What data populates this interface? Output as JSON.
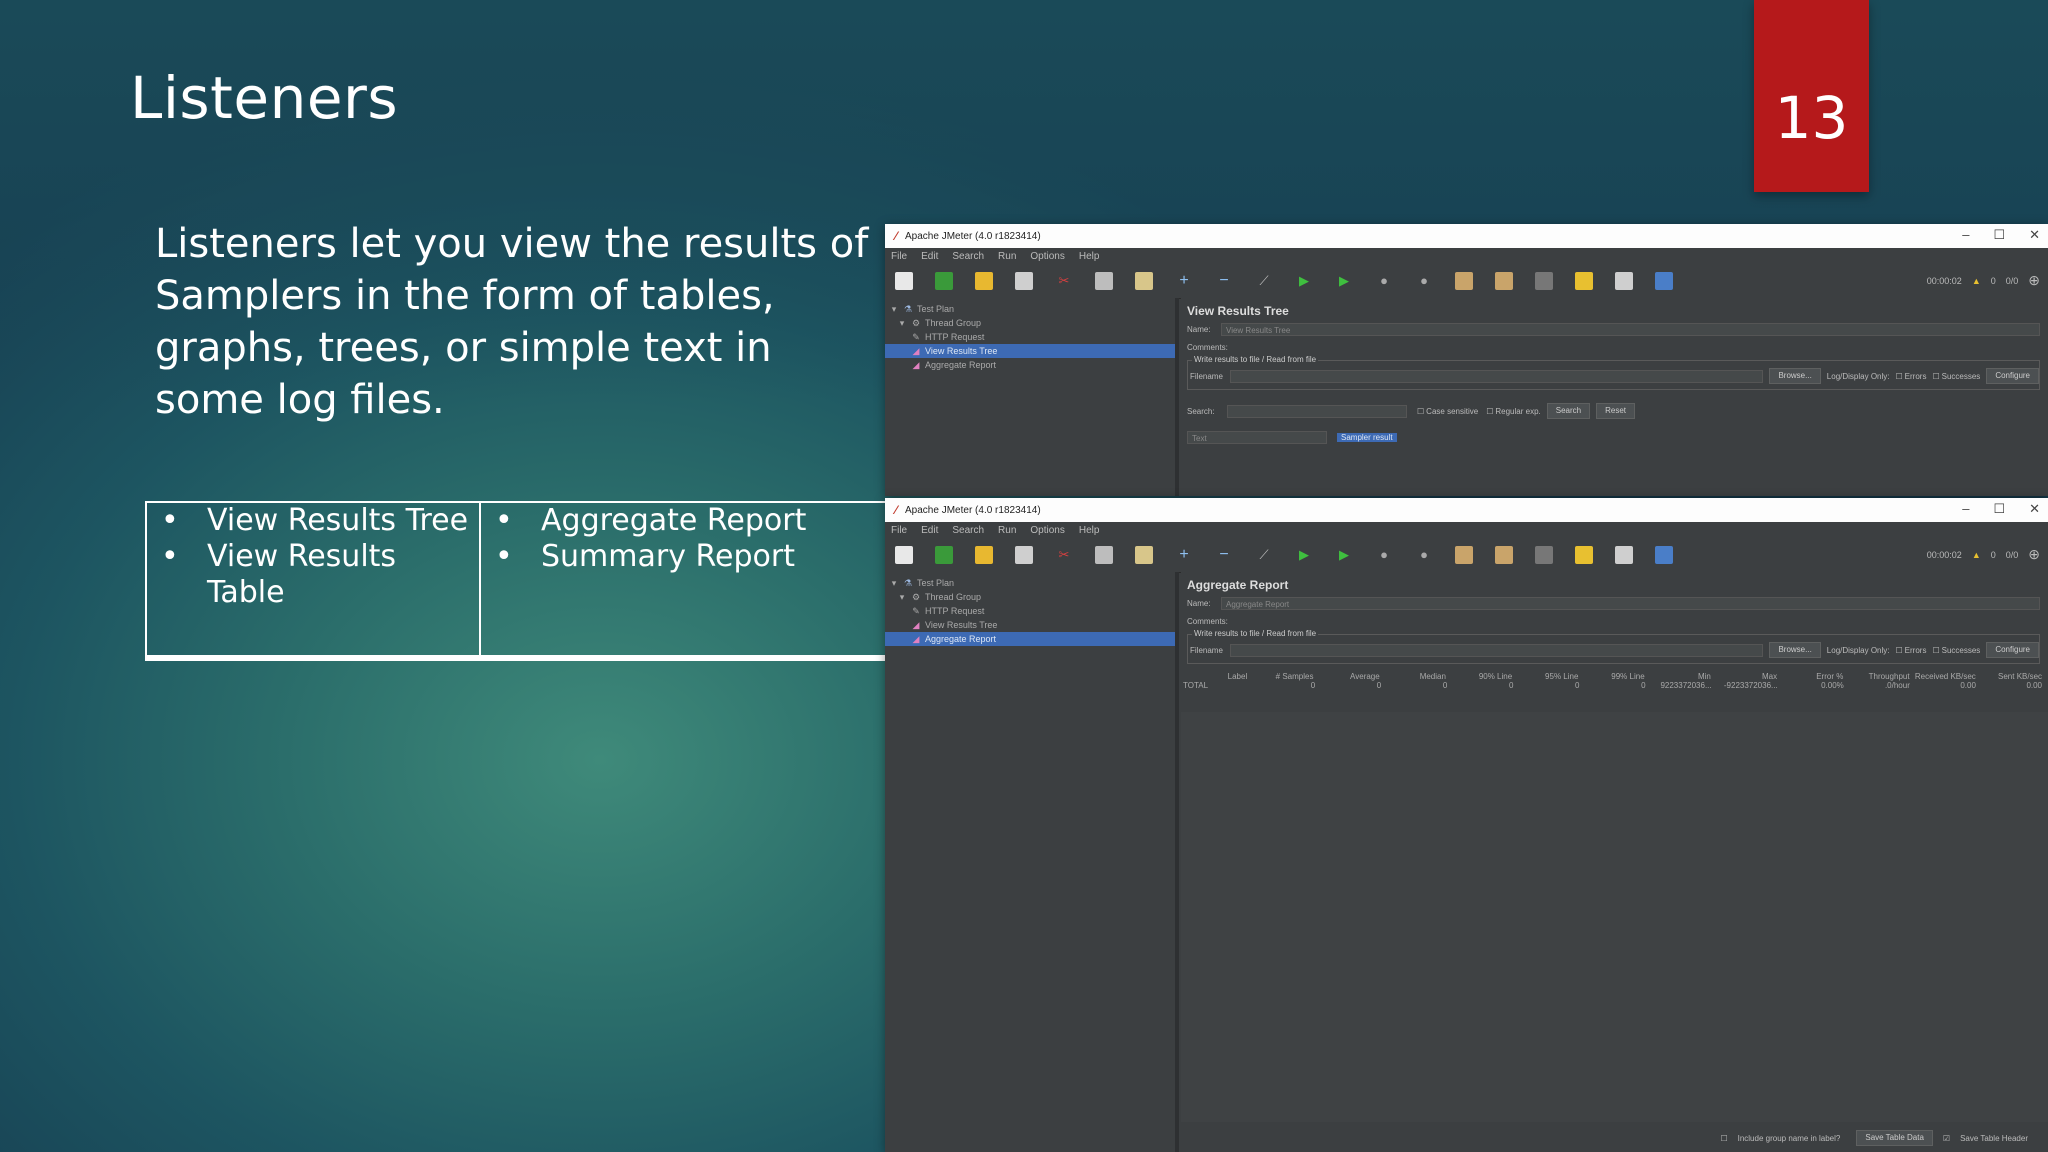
{
  "slide": {
    "title": "Listeners",
    "page_number": "13",
    "body": "Listeners let you view the results of Samplers in the form of tables, graphs, trees, or simple text in some log files.",
    "list_left": [
      "View Results Tree",
      "View Results Table"
    ],
    "list_right": [
      "Aggregate Report",
      "Summary Report"
    ],
    "bullet": "•",
    "accent_color": "#b5191b"
  },
  "window1": {
    "title": "Apache JMeter (4.0 r1823414)",
    "menu": [
      "File",
      "Edit",
      "Search",
      "Run",
      "Options",
      "Help"
    ],
    "timer": "00:00:02",
    "warn_count": "0",
    "thread_count": "0/0",
    "tree": [
      "Test Plan",
      "Thread Group",
      "HTTP Request",
      "View Results Tree",
      "Aggregate Report"
    ],
    "panel_title": "View Results Tree",
    "name_label": "Name:",
    "name_value": "View Results Tree",
    "comments_label": "Comments:",
    "group_label": "Write results to file / Read from file",
    "filename_label": "Filename",
    "browse_label": "Browse...",
    "log_display_label": "Log/Display Only:",
    "errors_label": "Errors",
    "successes_label": "Successes",
    "configure_label": "Configure",
    "search_label": "Search:",
    "case_sensitive_label": "Case sensitive",
    "regex_label": "Regular exp.",
    "search_button": "Search",
    "reset_button": "Reset",
    "renderer_value": "Text",
    "sampler_result_tab": "Sampler result"
  },
  "window2": {
    "title": "Apache JMeter (4.0 r1823414)",
    "menu": [
      "File",
      "Edit",
      "Search",
      "Run",
      "Options",
      "Help"
    ],
    "timer": "00:00:02",
    "warn_count": "0",
    "thread_count": "0/0",
    "tree": [
      "Test Plan",
      "Thread Group",
      "HTTP Request",
      "View Results Tree",
      "Aggregate Report"
    ],
    "panel_title": "Aggregate Report",
    "name_label": "Name:",
    "name_value": "Aggregate Report",
    "comments_label": "Comments:",
    "group_label": "Write results to file / Read from file",
    "filename_label": "Filename",
    "browse_label": "Browse...",
    "log_display_label": "Log/Display Only:",
    "errors_label": "Errors",
    "successes_label": "Successes",
    "configure_label": "Configure",
    "table_headers": [
      "Label",
      "# Samples",
      "Average",
      "Median",
      "90% Line",
      "95% Line",
      "99% Line",
      "Min",
      "Max",
      "Error %",
      "Throughput",
      "Received KB/sec",
      "Sent KB/sec"
    ],
    "table_row": [
      "TOTAL",
      "0",
      "0",
      "0",
      "0",
      "0",
      "0",
      "9223372036...",
      "-9223372036...",
      "0.00%",
      ".0/hour",
      "0.00",
      "0.00"
    ],
    "include_group_label": "Include group name in label?",
    "save_table_data": "Save Table Data",
    "save_table_header": "Save Table Header"
  }
}
